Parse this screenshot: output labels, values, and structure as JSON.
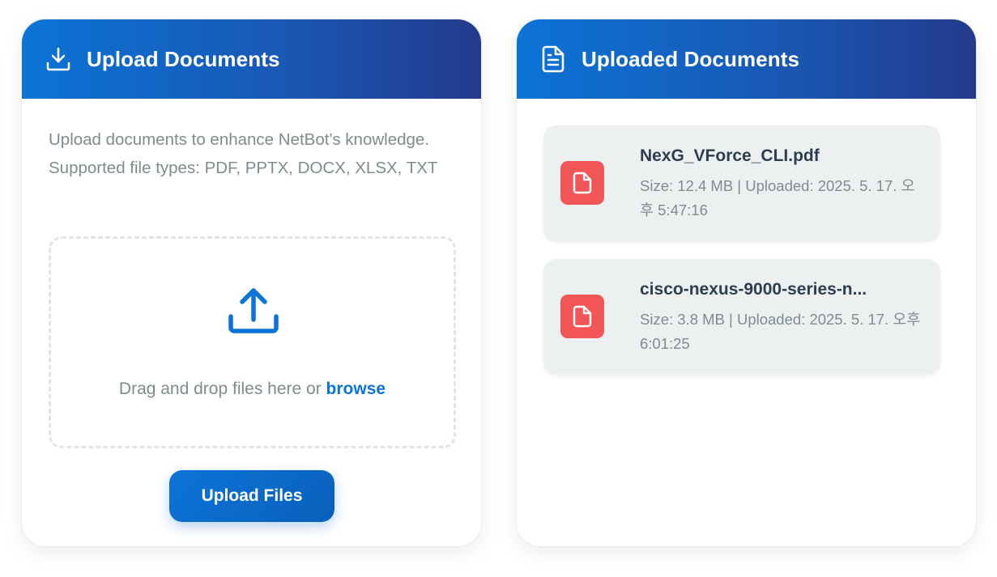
{
  "upload_card": {
    "title": "Upload Documents",
    "description": "Upload documents to enhance NetBot's knowledge. Supported file types: PDF, PPTX, DOCX, XLSX, TXT",
    "dropzone": {
      "text": "Drag and drop files here or ",
      "browse_label": "browse"
    },
    "upload_button_label": "Upload Files"
  },
  "uploaded_card": {
    "title": "Uploaded Documents",
    "documents": [
      {
        "name": "NexG_VForce_CLI.pdf",
        "meta": "Size: 12.4 MB | Uploaded: 2025. 5. 17. 오후 5:47:16",
        "icon": "pdf-file-icon"
      },
      {
        "name": "cisco-nexus-9000-series-n...",
        "meta": "Size: 3.8 MB | Uploaded: 2025. 5. 17. 오후 6:01:25",
        "icon": "pdf-file-icon"
      }
    ]
  },
  "colors": {
    "header_gradient_start": "#0b74d6",
    "header_gradient_end": "#233a8c",
    "accent": "#0b74d6",
    "file_icon_bg": "#f35656",
    "doc_item_bg": "#ecf0f1",
    "muted_text": "#7f8c8d",
    "dark_text": "#2c3e50"
  }
}
